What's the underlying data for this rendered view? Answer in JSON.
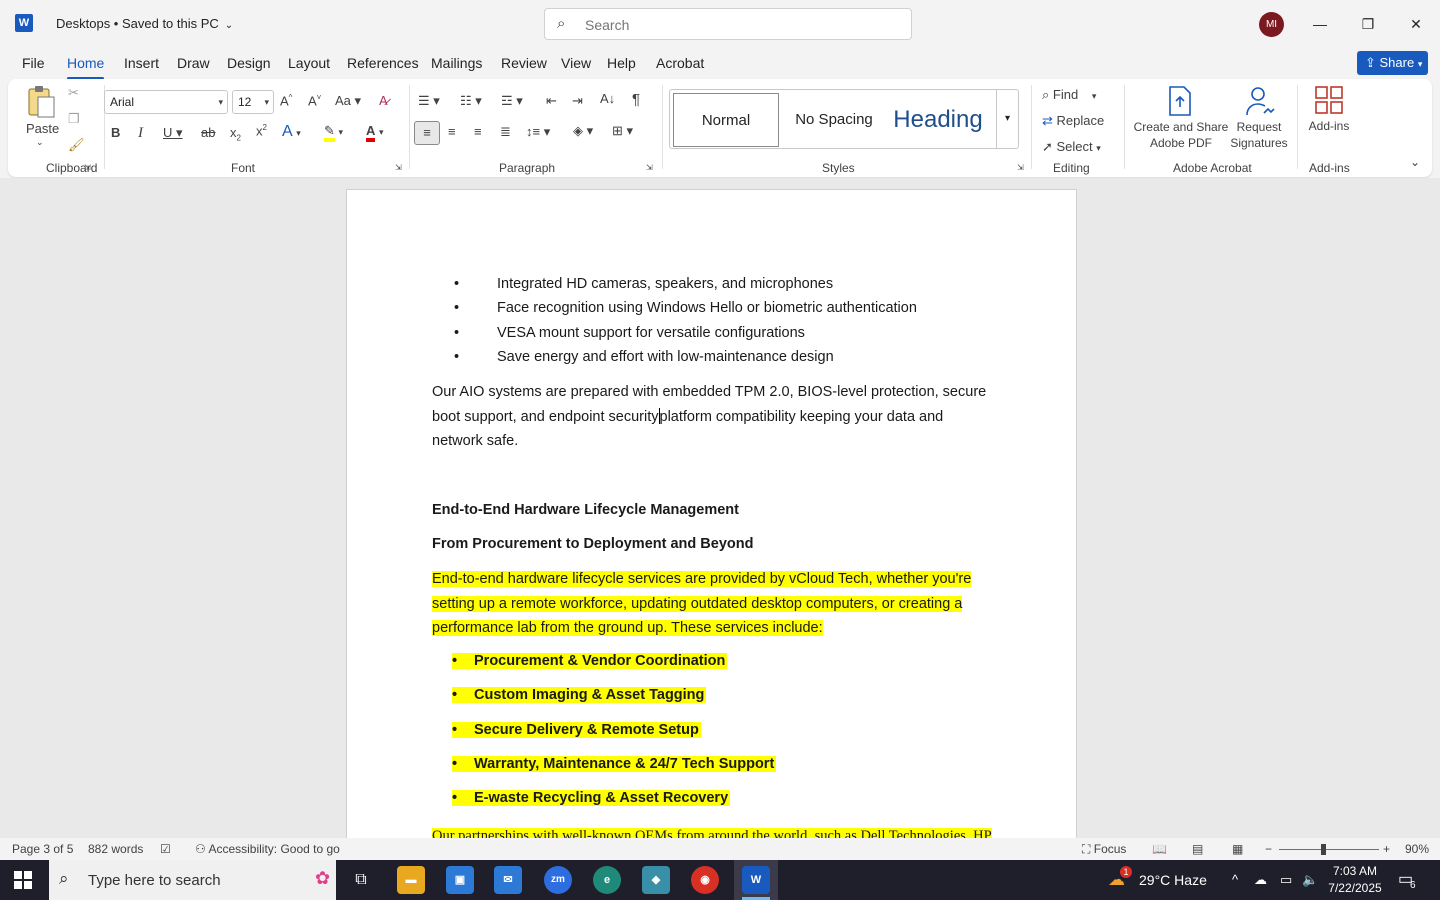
{
  "titlebar": {
    "app_logo": "W",
    "doc_title": "Desktops • Saved to this PC",
    "search_placeholder": "Search",
    "avatar_initials": "MI",
    "minimize": "—",
    "restore": "❐",
    "close": "✕"
  },
  "tabs": [
    "File",
    "Home",
    "Insert",
    "Draw",
    "Design",
    "Layout",
    "References",
    "Mailings",
    "Review",
    "View",
    "Help",
    "Acrobat"
  ],
  "share_label": "Share",
  "ribbon": {
    "clipboard": {
      "paste": "Paste",
      "label": "Clipboard"
    },
    "font": {
      "name": "Arial",
      "size": "12",
      "label": "Font"
    },
    "paragraph": {
      "label": "Paragraph"
    },
    "styles": {
      "normal": "Normal",
      "no_spacing": "No Spacing",
      "heading": "Heading",
      "label": "Styles"
    },
    "editing": {
      "find": "Find",
      "replace": "Replace",
      "select": "Select",
      "label": "Editing"
    },
    "acrobat": {
      "create_line1": "Create and Share",
      "create_line2": "Adobe PDF",
      "request_line1": "Request",
      "request_line2": "Signatures",
      "label": "Adobe Acrobat"
    },
    "addins": {
      "button": "Add-ins",
      "label": "Add-ins"
    }
  },
  "document": {
    "bullets": [
      "Integrated HD cameras, speakers, and microphones",
      "Face recognition using Windows Hello or biometric authentication",
      "VESA mount support for versatile configurations",
      "Save energy and effort with low-maintenance design"
    ],
    "bullet_char": "•",
    "para1_before": "Our AIO systems are prepared with embedded TPM 2.0, BIOS-level protection, secure boot support, and endpoint security",
    "para1_after": "platform compatibility keeping your data and network safe.",
    "heading1": "End-to-End Hardware Lifecycle Management",
    "heading2": "From Procurement to Deployment and Beyond",
    "para2": "End-to-end hardware lifecycle services are provided by vCloud Tech, whether you're setting up a remote workforce, updating outdated desktop computers, or creating a performance lab from the ground up. These services include:",
    "services": [
      "Procurement & Vendor Coordination",
      "Custom Imaging & Asset Tagging",
      "Secure Delivery & Remote Setup",
      "Warranty, Maintenance & 24/7 Tech Support",
      "E-waste Recycling & Asset Recovery"
    ],
    "para3_partial": "Our partnerships with well-known OEMs from around the world, such as Dell Technologies, HP"
  },
  "statusbar": {
    "page": "Page 3 of 5",
    "words": "882 words",
    "accessibility": "Accessibility: Good to go",
    "focus": "Focus",
    "zoom": "90%",
    "zoom_level": 0.9
  },
  "taskbar": {
    "search_placeholder": "Type here to search",
    "weather": "29°C  Haze",
    "time": "7:03 AM",
    "date": "7/22/2025",
    "notifications": "6",
    "weather_badge": "1"
  },
  "colors": {
    "accent": "#185abd",
    "highlight": "#ffff00",
    "avatar": "#7a1a20"
  }
}
